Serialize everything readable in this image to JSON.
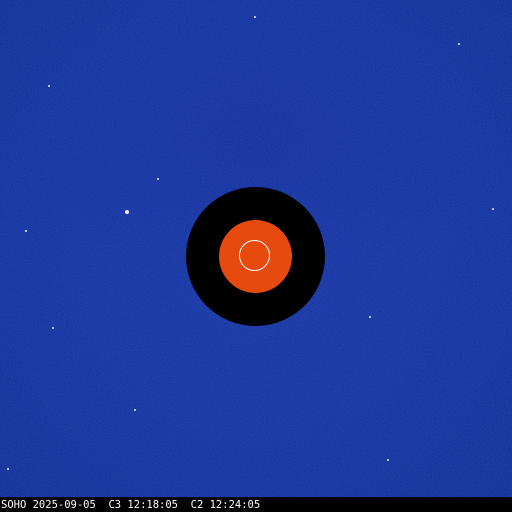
{
  "caption": {
    "text": "SOHO 2025-09-05  C3 12:18:05  C2 12:24:05"
  },
  "colors": {
    "background": "#1a38a3",
    "occulter_outer": "#000000",
    "occulter_inner": "#e64a0c",
    "sun_outline": "#ffffff",
    "caption_bar": "#000000",
    "caption_text": "#ffffff"
  }
}
